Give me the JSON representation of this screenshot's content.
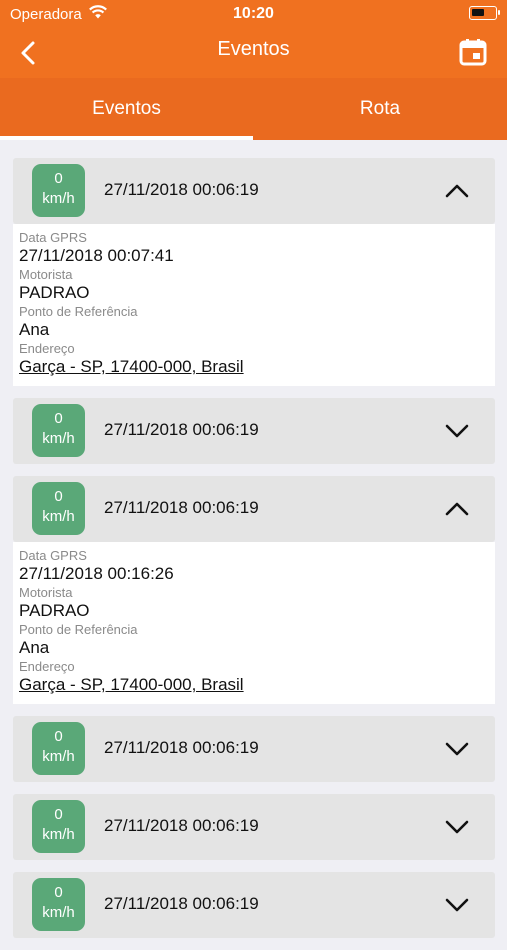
{
  "status_bar": {
    "carrier": "Operadora",
    "time": "10:20"
  },
  "nav": {
    "title": "Eventos"
  },
  "tabs": [
    {
      "label": "Eventos",
      "selected": true
    },
    {
      "label": "Rota",
      "selected": false
    }
  ],
  "events": [
    {
      "speed_value": "0",
      "speed_unit": "km/h",
      "date": "27/11/2018 00:06:19",
      "expanded": true,
      "details": {
        "gprs_label": "Data GPRS",
        "gprs_value": "27/11/2018 00:07:41",
        "driver_label": "Motorista",
        "driver_value": "PADRAO",
        "ref_label": "Ponto de Referência",
        "ref_value": "Ana",
        "address_label": "Endereço",
        "address_value": "Garça - SP, 17400-000, Brasil"
      }
    },
    {
      "speed_value": "0",
      "speed_unit": "km/h",
      "date": "27/11/2018 00:06:19",
      "expanded": false
    },
    {
      "speed_value": "0",
      "speed_unit": "km/h",
      "date": "27/11/2018 00:06:19",
      "expanded": true,
      "details": {
        "gprs_label": "Data GPRS",
        "gprs_value": "27/11/2018 00:16:26",
        "driver_label": "Motorista",
        "driver_value": "PADRAO",
        "ref_label": "Ponto de Referência",
        "ref_value": "Ana",
        "address_label": "Endereço",
        "address_value": "Garça - SP, 17400-000, Brasil"
      }
    },
    {
      "speed_value": "0",
      "speed_unit": "km/h",
      "date": "27/11/2018 00:06:19",
      "expanded": false
    },
    {
      "speed_value": "0",
      "speed_unit": "km/h",
      "date": "27/11/2018 00:06:19",
      "expanded": false
    },
    {
      "speed_value": "0",
      "speed_unit": "km/h",
      "date": "27/11/2018 00:06:19",
      "expanded": false
    }
  ],
  "colors": {
    "primary": "#f07120",
    "tab_bar": "#ea6a1f",
    "speed_badge": "#5aa878",
    "card_header": "#e4e4e4",
    "background": "#efeff4"
  },
  "icons": {
    "back": "chevron-left-icon",
    "calendar": "calendar-icon",
    "expand": "chevron-down-icon",
    "collapse": "chevron-up-icon",
    "wifi": "wifi-icon",
    "battery": "battery-icon"
  }
}
